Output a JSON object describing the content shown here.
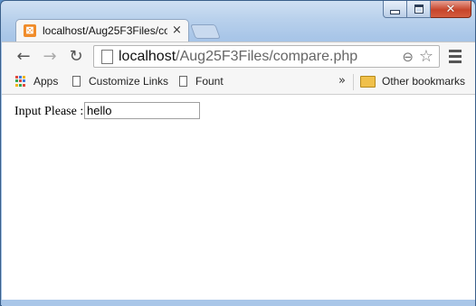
{
  "window": {
    "caption_buttons": {
      "minimize": "",
      "maximize": "",
      "close": "✕"
    }
  },
  "tab": {
    "title": "localhost/Aug25F3Files/co",
    "favicon": "xampp-icon",
    "close_label": "×"
  },
  "toolbar": {
    "back_glyph": "←",
    "forward_glyph": "→",
    "reload_glyph": "↻",
    "url_host": "localhost",
    "url_path": "/Aug25F3Files/compare.php",
    "zoom_glyph": "⊖",
    "star_glyph": "☆"
  },
  "bookmarks": {
    "items": [
      {
        "label": "Apps",
        "icon": "apps-grid-icon"
      },
      {
        "label": "Customize Links",
        "icon": "page-icon"
      },
      {
        "label": "Fount",
        "icon": "page-icon"
      }
    ],
    "overflow_glyph": "»",
    "other": {
      "label": "Other bookmarks",
      "icon": "folder-icon"
    }
  },
  "page": {
    "input_label": "Input Please :",
    "input_value": "hello"
  },
  "colors": {
    "frame": "#a9c6e8",
    "close_button": "#c7452b",
    "favicon": "#f08c2a"
  }
}
